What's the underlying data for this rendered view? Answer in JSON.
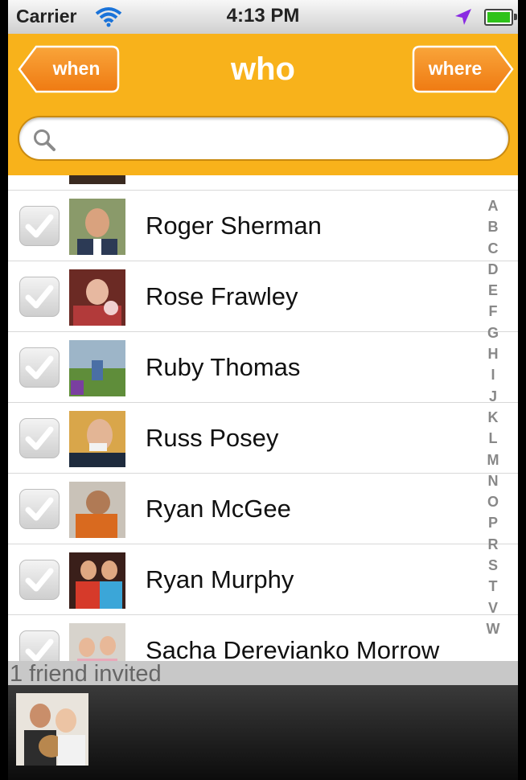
{
  "status_bar": {
    "carrier": "Carrier",
    "time": "4:13 PM"
  },
  "header": {
    "title": "who",
    "back_label": "when",
    "forward_label": "where",
    "search_placeholder": ""
  },
  "friends": [
    {
      "name": "Roger Sherman"
    },
    {
      "name": "Rose Frawley"
    },
    {
      "name": "Ruby Thomas"
    },
    {
      "name": "Russ Posey"
    },
    {
      "name": "Ryan McGee"
    },
    {
      "name": "Ryan Murphy"
    },
    {
      "name": "Sacha Derevianko Morrow"
    }
  ],
  "index_letters": [
    "A",
    "B",
    "C",
    "D",
    "E",
    "F",
    "G",
    "H",
    "I",
    "J",
    "K",
    "L",
    "M",
    "N",
    "O",
    "P",
    "R",
    "S",
    "T",
    "V",
    "W"
  ],
  "footer": {
    "invited_text": "1 friend invited"
  },
  "colors": {
    "header_orange": "#f8b21b",
    "button_orange": "#f48a1a"
  },
  "icons": {
    "search": "magnifier-icon",
    "checkbox": "checkmark-icon"
  }
}
